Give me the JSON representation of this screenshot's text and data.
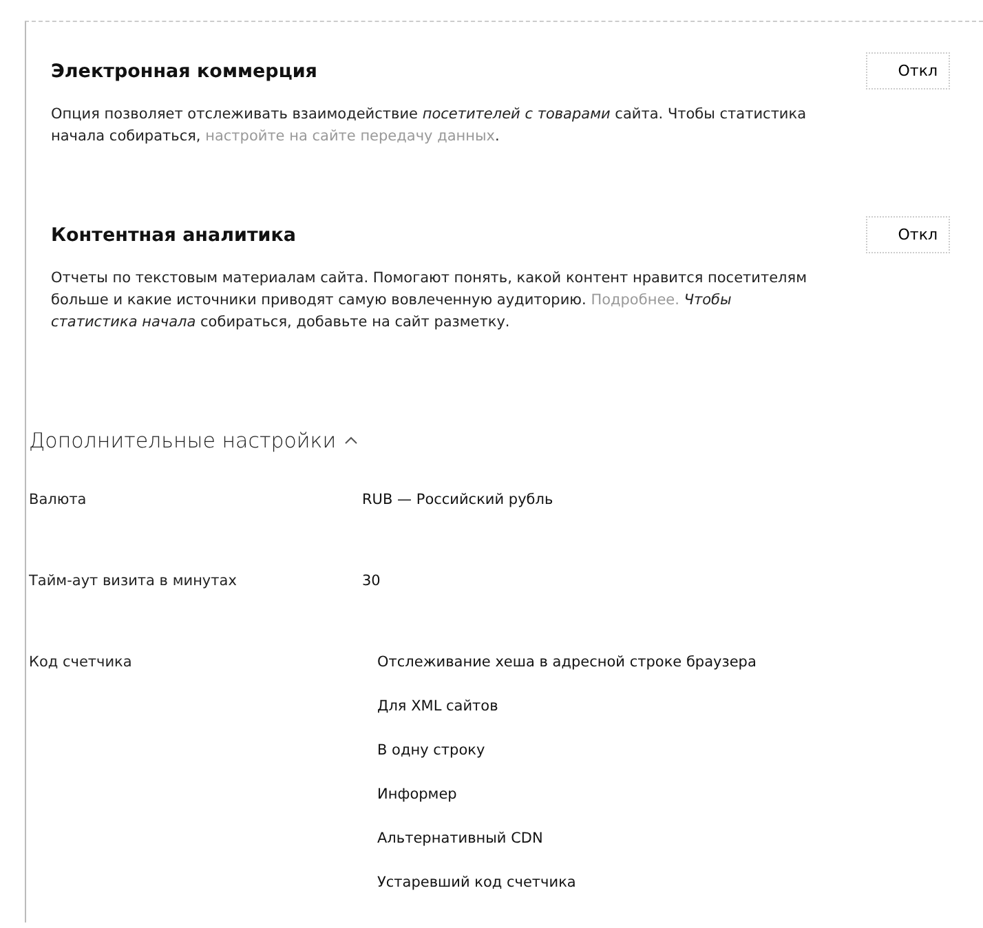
{
  "sections": [
    {
      "title": "Электронная коммерция",
      "toggle": {
        "label": "Откл",
        "on": false
      },
      "description": [
        {
          "kind": "text",
          "text": "Опция позволяет отслеживать взаимодействие *посетителей с товарами* сайта. Чтобы статистика начала собираться, "
        },
        {
          "kind": "link",
          "text": "настройте на сайте передачу данных"
        },
        {
          "kind": "text",
          "text": "."
        }
      ]
    },
    {
      "title": "Контентная аналитика",
      "toggle": {
        "label": "Откл",
        "on": false
      },
      "description": [
        {
          "kind": "text",
          "text": "Отчеты по текстовым материалам сайта. Помогают понять, какой контент нравится посетителям больше и какие источники приводят самую вовлеченную аудиторию. "
        },
        {
          "kind": "link",
          "text": "Подробнее."
        },
        {
          "kind": "text",
          "text": " *Чтобы статистика начала* собираться, добавьте на сайт разметку."
        }
      ]
    }
  ],
  "advanced": {
    "title": "Дополнительные настройки",
    "expanded": true,
    "rows": [
      {
        "kind": "value",
        "label": "Валюта",
        "value": "RUB — Российский рубль"
      },
      {
        "kind": "value",
        "label": "Тайм-аут визита в минутах",
        "value": "30"
      },
      {
        "kind": "options",
        "label": "Код счетчика",
        "options": [
          "Отслеживание хеша в адресной строке браузера",
          "Для XML сайтов",
          "В одну строку",
          "Информер",
          "Альтернативный CDN",
          "Устаревший код счетчика"
        ]
      }
    ]
  }
}
